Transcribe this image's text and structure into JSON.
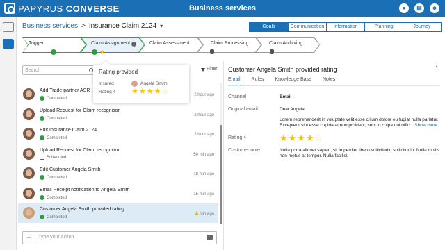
{
  "app": {
    "brand_light": "PAPYRUS ",
    "brand_bold": "CONVERSE",
    "title": "Business services",
    "top_icons": [
      "bell-icon",
      "chat-icon",
      "user-icon"
    ]
  },
  "breadcrumb": {
    "parent": "Business services",
    "separator": ">",
    "current": "Insurance Claim 2124",
    "caret": "▾"
  },
  "top_tabs": [
    {
      "label": "Goals",
      "active": true
    },
    {
      "label": "Communication",
      "active": false
    },
    {
      "label": "Information",
      "active": false
    },
    {
      "label": "Planning",
      "active": false
    },
    {
      "label": "Journey",
      "active": false
    }
  ],
  "stepper": [
    {
      "label": "Trigger",
      "state": "done"
    },
    {
      "label": "Claim Assignment",
      "state": "active"
    },
    {
      "label": "Claim Assessment",
      "state": "pending"
    },
    {
      "label": "Claim Processing",
      "state": "locked"
    },
    {
      "label": "Claim Archiving",
      "state": "locked"
    }
  ],
  "search": {
    "placeholder": "Search"
  },
  "filter": {
    "label": "Filter"
  },
  "popover": {
    "title": "Rating provided",
    "insured_label": "Insured",
    "insured_value": "Angela Smith",
    "rating_label": "Rating 4",
    "rating": 4,
    "rating_max": 5
  },
  "activities": [
    {
      "title": "Add Trade partner ASR Heal",
      "status": "Completed",
      "status_type": "completed",
      "time": "2 hour ago",
      "avatar": "male"
    },
    {
      "title": "Upload Request for Claim recognition",
      "status": "Completed",
      "status_type": "completed",
      "time": "2 hour ago",
      "avatar": "male"
    },
    {
      "title": "Edit Insurance Claim 2124",
      "status": "Completed",
      "status_type": "completed",
      "time": "2 hour ago",
      "avatar": "male"
    },
    {
      "title": "Upload Request for Claim recognition",
      "status": "Scheduled",
      "status_type": "scheduled",
      "time": "50 min ago",
      "avatar": "male"
    },
    {
      "title": "Edit Customer Angela Smith",
      "status": "Completed",
      "status_type": "completed",
      "time": "18 min ago",
      "avatar": "male"
    },
    {
      "title": "Email Receipt notification to Angela Smith",
      "status": "Completed",
      "status_type": "completed",
      "time": "15 min ago",
      "avatar": "male"
    },
    {
      "title": "Customer Angela Smith provided rating",
      "status": "Completed",
      "status_type": "completed",
      "time": "1 min ago",
      "avatar": "female",
      "selected": true
    }
  ],
  "action_input": {
    "placeholder": "Type your action",
    "add": "+"
  },
  "detail": {
    "title": "Customer Angela Smith provided rating",
    "tabs": [
      {
        "label": "Email",
        "active": true
      },
      {
        "label": "Rules",
        "active": false
      },
      {
        "label": "Knowledge Base",
        "active": false
      },
      {
        "label": "Notes",
        "active": false
      }
    ],
    "channel_label": "Channel",
    "channel_value": "Email",
    "original_email_label": "Original email",
    "greeting": "Dear Angela,",
    "email_body": "Lorem reprehenderit in voluptate velit esse cillum dolore eu fugiat nulla pariatur. Excepteur sint esse cupidatat non proident, sunt in culpa qui offic...",
    "show_more": "Show more",
    "rating_label": "Rating 4",
    "rating": 4,
    "rating_max": 5,
    "note_label": "Customer note",
    "note_value": "Nulla porta aliquet sapien, sit imperdiet libero sollicitudin sollicitudin. Nulla mollis non metus at tempor. Nulla facilisi."
  },
  "colors": {
    "brand": "#1a6fb5",
    "success": "#2e9e3e",
    "star": "#f5c400",
    "selected_row": "#ddebf7"
  }
}
